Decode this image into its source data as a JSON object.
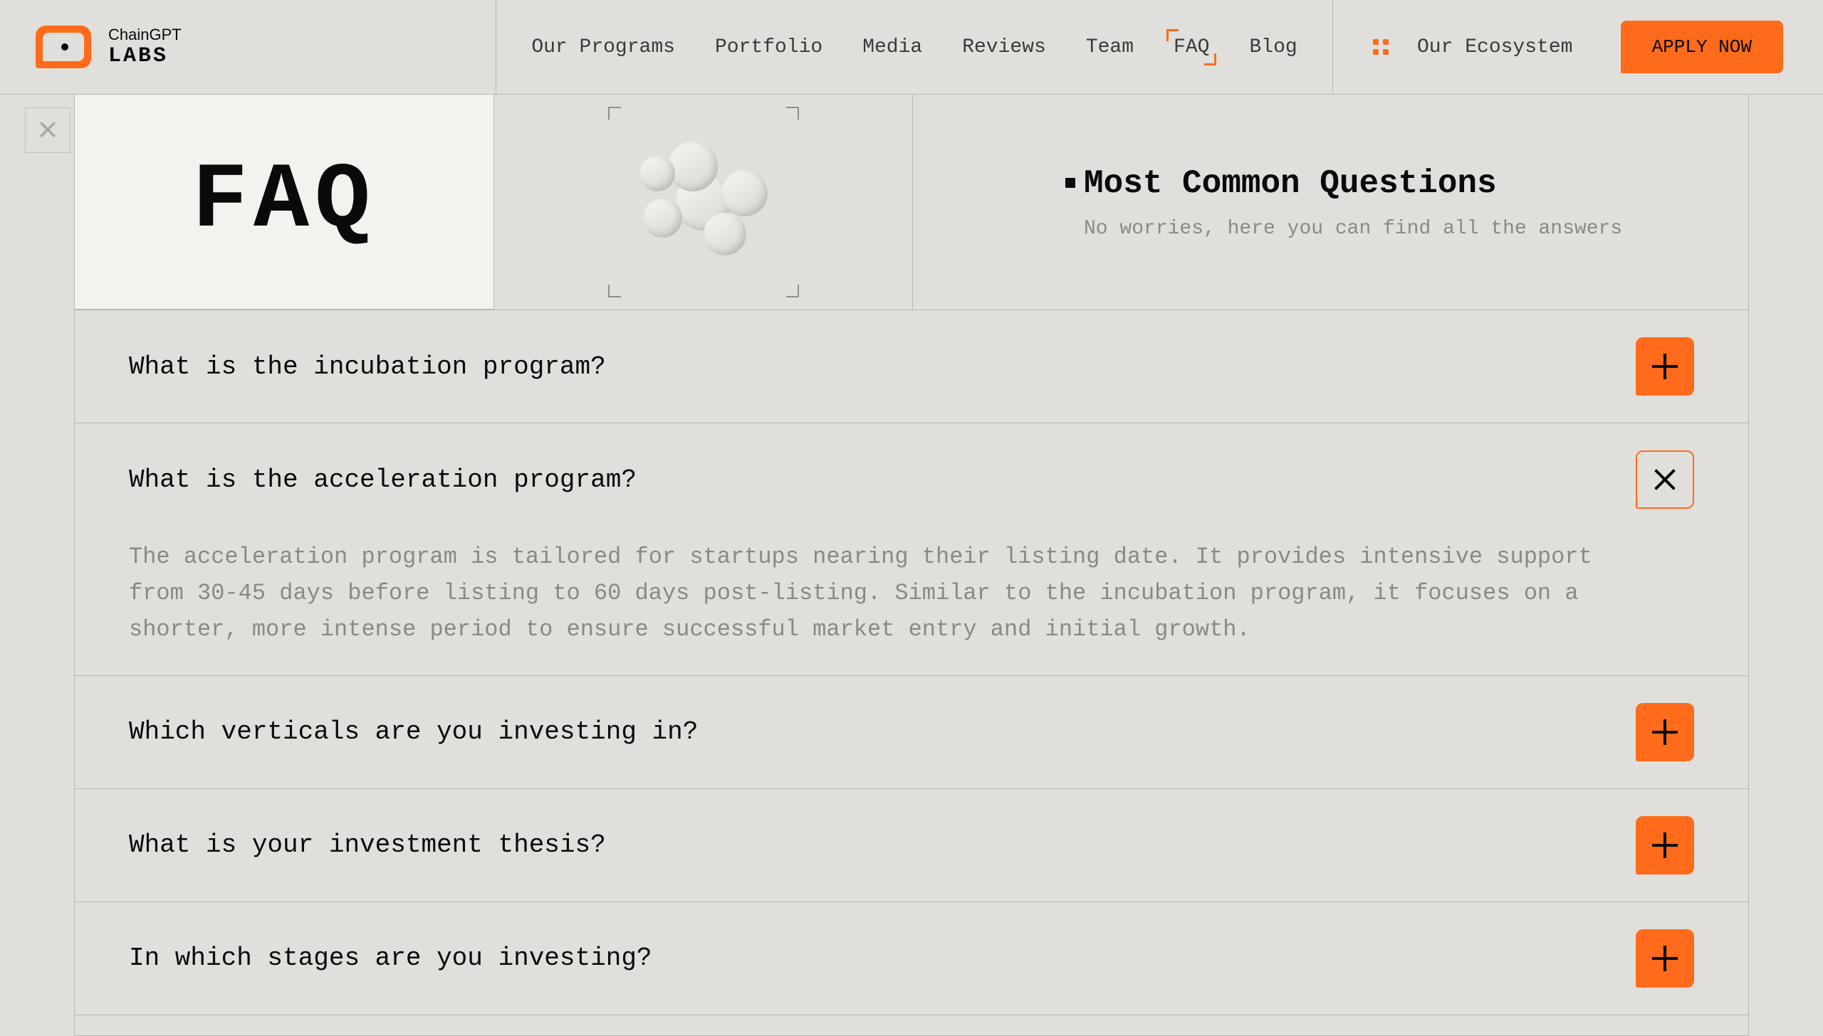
{
  "brand": {
    "top": "ChainGPT",
    "bottom": "LABS"
  },
  "nav": {
    "items": [
      "Our Programs",
      "Portfolio",
      "Media",
      "Reviews",
      "Team",
      "FAQ",
      "Blog"
    ],
    "active": "FAQ"
  },
  "ecosystem": "Our Ecosystem",
  "apply": "APPLY NOW",
  "hero": {
    "faq_title": "FAQ",
    "heading": "Most Common Questions",
    "sub": "No worries, here you can find all the answers"
  },
  "faq": [
    {
      "q": "What is the incubation program?",
      "expanded": false
    },
    {
      "q": "What is the acceleration program?",
      "expanded": true,
      "a": "The acceleration program is tailored for startups nearing their listing date. It provides intensive support from 30-45 days before listing to 60 days post-listing. Similar to the incubation program, it focuses on a shorter, more intense period to ensure successful market entry and initial growth."
    },
    {
      "q": "Which verticals are you investing in?",
      "expanded": false
    },
    {
      "q": "What is your investment thesis?",
      "expanded": false
    },
    {
      "q": "In which stages are you investing?",
      "expanded": false
    }
  ]
}
